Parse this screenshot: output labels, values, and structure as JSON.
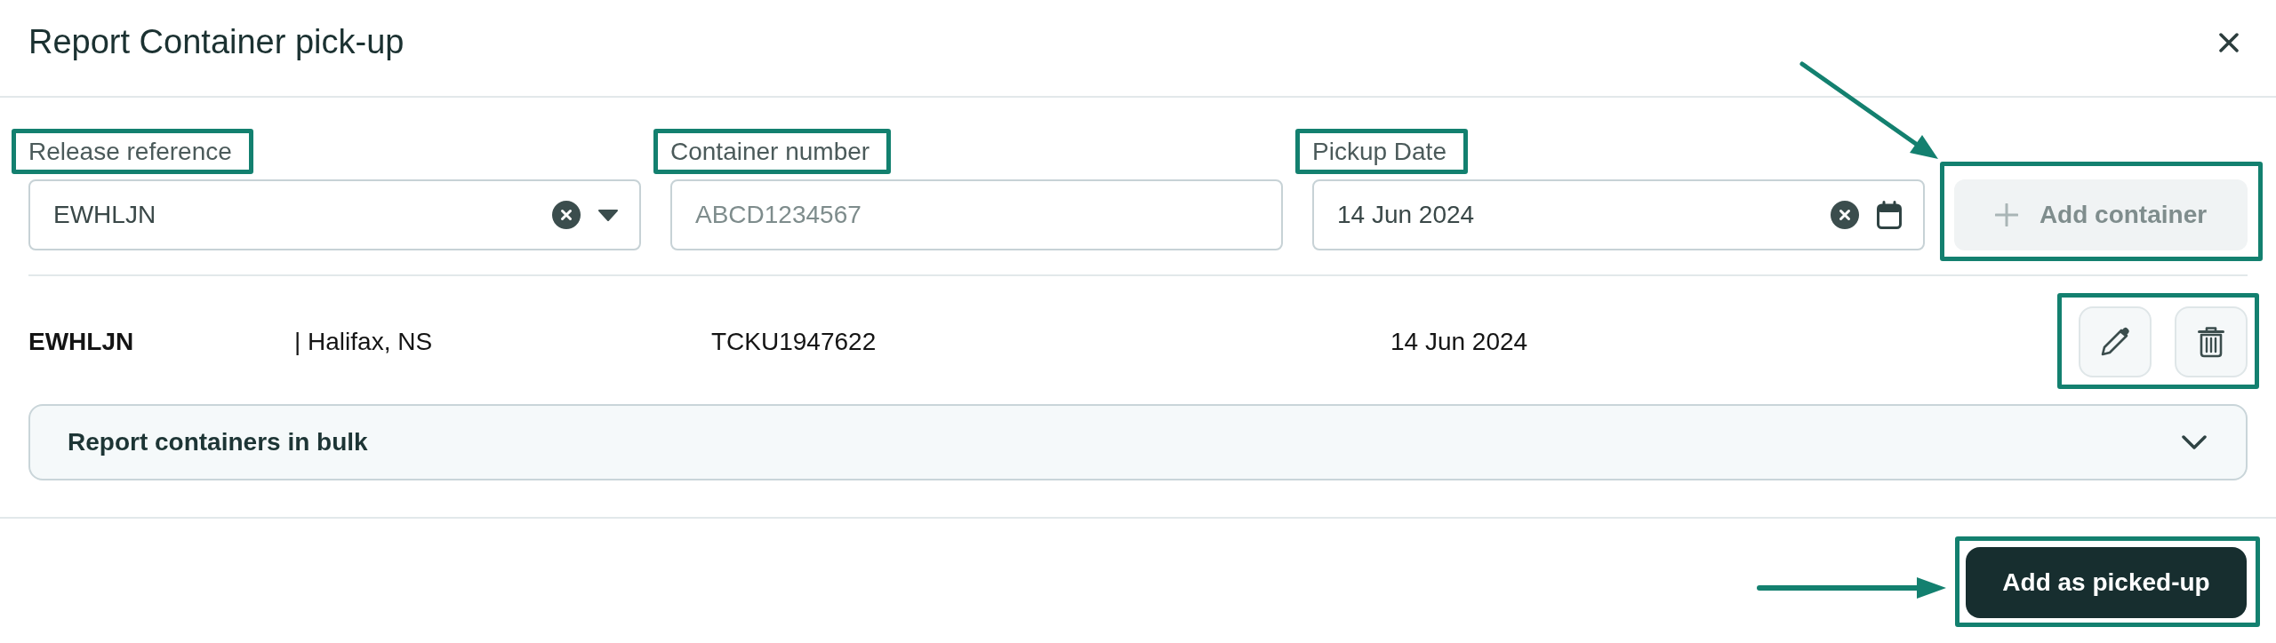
{
  "dialog": {
    "title": "Report Container pick-up"
  },
  "form": {
    "fields": [
      {
        "kind": "select",
        "label": "Release reference",
        "value": "EWHLJN",
        "highlighted": true
      },
      {
        "kind": "text",
        "label": "Container number",
        "placeholder": "ABCD1234567",
        "highlighted": true
      },
      {
        "kind": "date",
        "label": "Pickup Date",
        "value": "14 Jun 2024",
        "highlighted": true
      }
    ],
    "add_button": {
      "label": "Add container",
      "disabled": true,
      "highlighted": true,
      "arrow": true
    }
  },
  "containers": [
    {
      "reference": "EWHLJN",
      "location": "| Halifax, NS",
      "container_number": "TCKU1947622",
      "pickup_date": "14 Jun 2024",
      "actions_highlighted": true
    }
  ],
  "bulk_section": {
    "title": "Report containers in bulk",
    "expanded": false
  },
  "footer": {
    "submit_button": {
      "label": "Add as picked-up",
      "highlighted": true,
      "arrow": true
    }
  }
}
